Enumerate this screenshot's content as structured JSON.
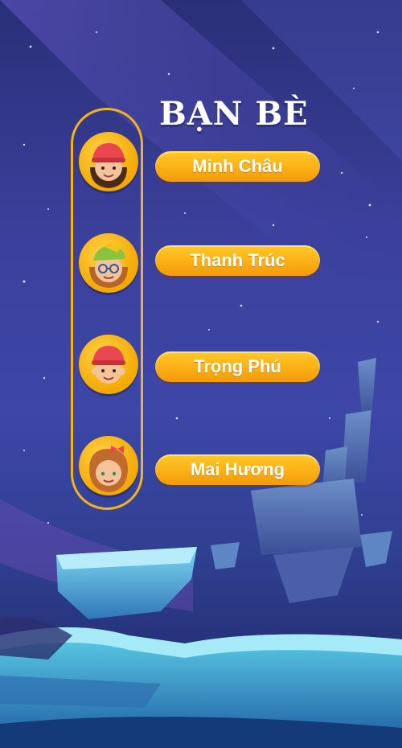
{
  "title": "BẠN BÈ",
  "friends": [
    {
      "name": "Minh Châu",
      "avatar": "girl-red-beanie-icon"
    },
    {
      "name": "Thanh Trúc",
      "avatar": "girl-green-cap-glasses-icon"
    },
    {
      "name": "Trọng Phú",
      "avatar": "boy-red-beanie-icon"
    },
    {
      "name": "Mai Hương",
      "avatar": "girl-red-bow-icon"
    }
  ],
  "colors": {
    "accent": "#f4b31a",
    "button": "#fbb015",
    "background": "#3b3f9a"
  }
}
